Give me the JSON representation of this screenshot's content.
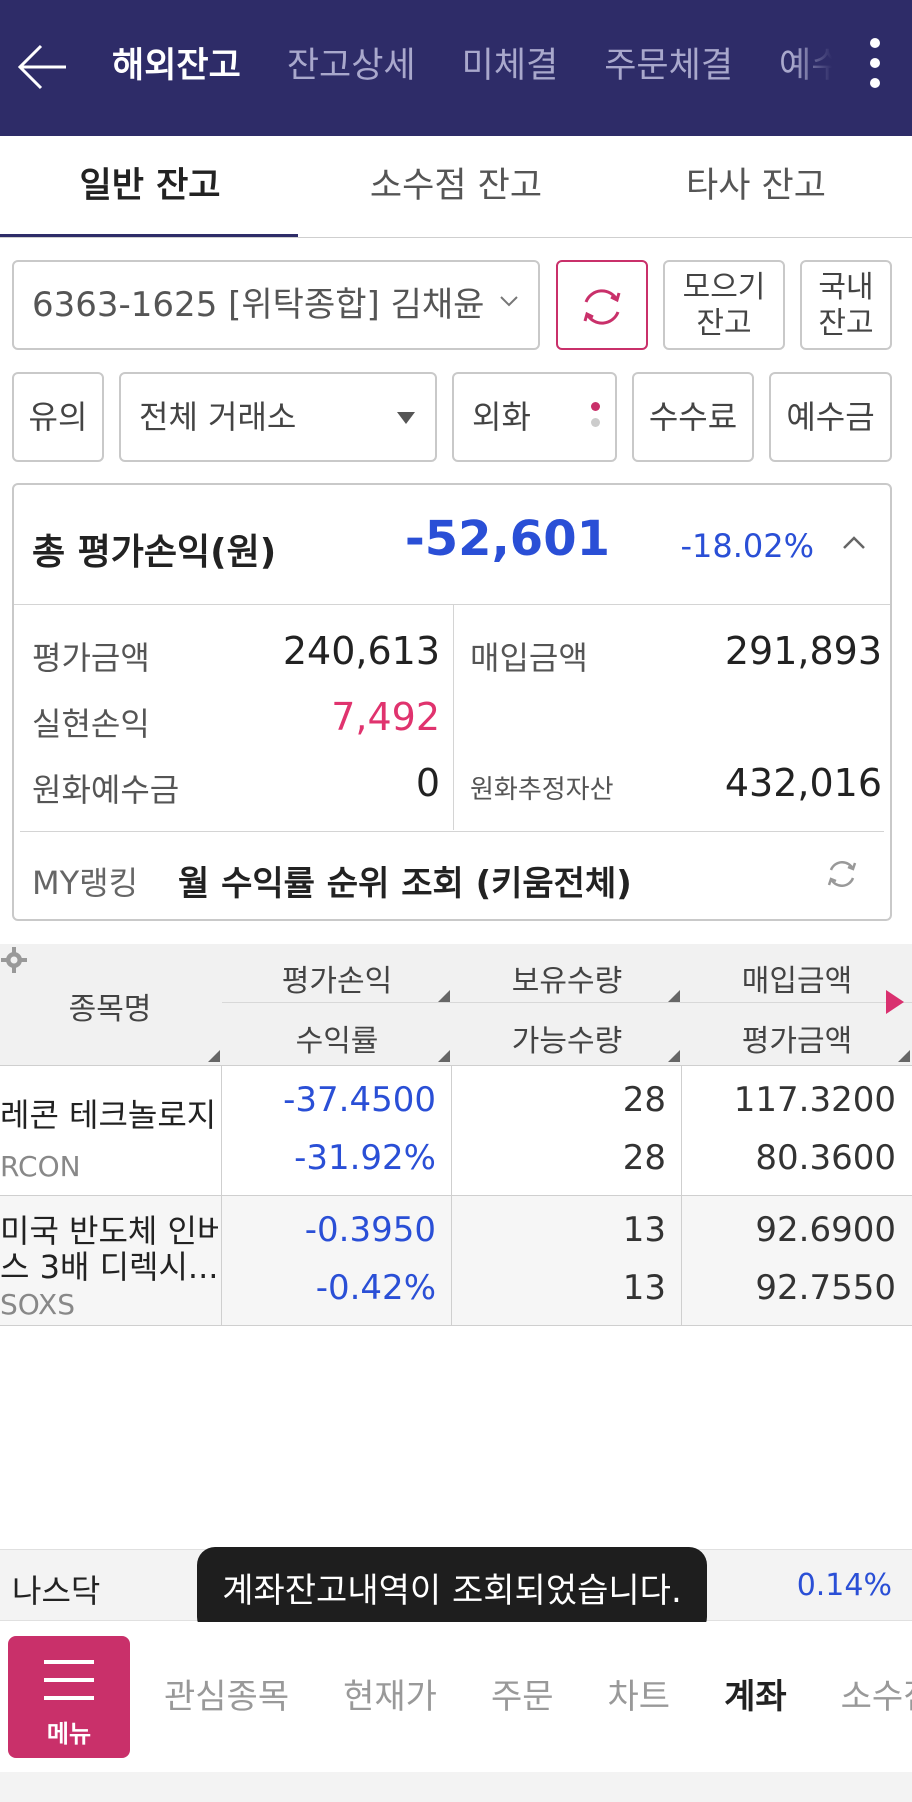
{
  "header": {
    "tabs": [
      "해외잔고",
      "잔고상세",
      "미체결",
      "주문체결",
      "예수금"
    ],
    "active_tab": "해외잔고"
  },
  "subtabs": [
    "일반 잔고",
    "소수점 잔고",
    "타사 잔고"
  ],
  "controls": {
    "account": "6363-1625 [위탁종합] 김채윤",
    "moa_line1": "모으기",
    "moa_line2": "잔고",
    "domestic_line1": "국내",
    "domestic_line2": "잔고",
    "caution": "유의",
    "exchange": "전체 거래소",
    "currency": "외화",
    "fee": "수수료",
    "deposit": "예수금"
  },
  "summary": {
    "title": "총 평가손익(원)",
    "total_pl": "-52,601",
    "total_rate": "-18.02%",
    "eval_amount_label": "평가금액",
    "eval_amount": "240,613",
    "purchase_amount_label": "매입금액",
    "purchase_amount": "291,893",
    "realized_pl_label": "실현손익",
    "realized_pl": "7,492",
    "krw_deposit_label": "원화예수금",
    "krw_deposit": "0",
    "krw_est_assets_label": "원화추정자산",
    "krw_est_assets": "432,016",
    "ranking_label": "MY랭킹",
    "ranking_link": "월 수익률 순위 조회 (키움전체)"
  },
  "table": {
    "headers": {
      "name": "종목명",
      "pl": "평가손익",
      "rate": "수익률",
      "qty": "보유수량",
      "avail": "가능수량",
      "purchase": "매입금액",
      "eval": "평가금액"
    },
    "rows": [
      {
        "name": "레콘 테크놀로지",
        "code": "RCON",
        "pl": "-37.4500",
        "rate": "-31.92%",
        "qty": "28",
        "avail": "28",
        "purchase": "117.3200",
        "eval": "80.3600"
      },
      {
        "name_line1": "미국 반도체 인버",
        "name_line2": "스 3배 디렉시...",
        "code": "SOXS",
        "pl": "-0.3950",
        "rate": "-0.42%",
        "qty": "13",
        "avail": "13",
        "purchase": "92.6900",
        "eval": "92.7550"
      }
    ]
  },
  "index_strip": {
    "name": "나스닥",
    "rate": "0.14%"
  },
  "toast": "계좌잔고내역이 조회되었습니다.",
  "bottom_nav": {
    "menu_label": "메뉴",
    "items": [
      "관심종목",
      "현재가",
      "주문",
      "차트",
      "계좌",
      "소수점"
    ],
    "active": "계좌"
  },
  "colors": {
    "header_bg": "#2e2c68",
    "accent": "#c9306a",
    "negative_blue": "#2a4fd6",
    "positive_red": "#e0336e"
  }
}
